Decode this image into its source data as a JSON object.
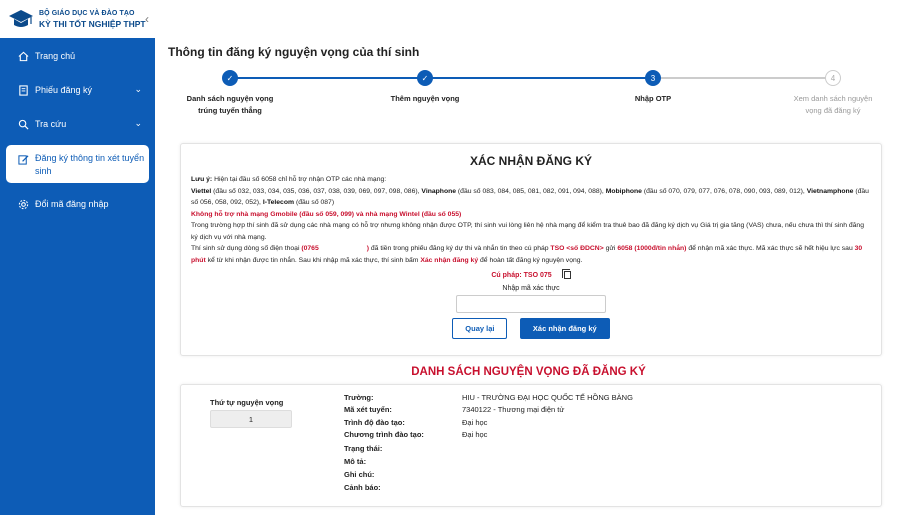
{
  "brand": {
    "line1": "BỘ GIÁO DỤC VÀ ĐÀO TẠO",
    "line2": "KỲ THI TỐT NGHIỆP THPT"
  },
  "sidebar": {
    "items": [
      {
        "label": "Trang chủ",
        "icon": "home-icon"
      },
      {
        "label": "Phiếu đăng ký",
        "icon": "document-icon"
      },
      {
        "label": "Tra cứu",
        "icon": "search-icon"
      },
      {
        "label": "Đăng ký thông tin xét tuyển sinh",
        "icon": "edit-icon"
      },
      {
        "label": "Đổi mã đăng nhập",
        "icon": "gear-icon"
      }
    ]
  },
  "page": {
    "title": "Thông tin đăng ký nguyện vọng của thí sinh"
  },
  "stepper": {
    "steps": [
      {
        "label": "Danh sách nguyện vọng trúng tuyển thẳng",
        "number": "",
        "state": "done"
      },
      {
        "label": "Thêm nguyện vọng",
        "number": "",
        "state": "done"
      },
      {
        "label": "Nhập OTP",
        "number": "3",
        "state": "active"
      },
      {
        "label": "Xem danh sách nguyện vọng đã đăng ký",
        "number": "4",
        "state": "todo"
      }
    ]
  },
  "otp": {
    "title": "XÁC NHẬN ĐĂNG KÝ",
    "note_label": "Lưu ý:",
    "note_text": "Hiện tại đầu số 6058 chỉ hỗ trợ nhận OTP các nhà mạng:",
    "viettel_name": "Viettel",
    "viettel_prefixes": "(đầu số 032, 033, 034, 035, 036, 037, 038, 039, 069, 097, 098, 086),",
    "vinaphone_name": "Vinaphone",
    "vinaphone_prefixes": "(đầu số 083, 084, 085, 081, 082, 091, 094, 088),",
    "mobiphone_name": "Mobiphone",
    "mobiphone_prefixes": "(đầu số 070, 079, 077, 076, 078, 090, 093, 089, 012),",
    "vietnamphone_name": "Vietnamphone",
    "vietnamphone_prefixes": "(đầu số 056, 058, 092, 052),",
    "itelecom_name": "I-Telecom",
    "itelecom_prefixes": "(đầu số 087)",
    "unsupported": "Không hỗ trợ nhà mạng Gmobile (đầu số 059, 099) và nhà mạng Wintel (đầu số 055)",
    "vas_note": "Trong trường hợp thí sinh đã sử dụng các nhà mạng có hỗ trợ nhưng không nhận được OTP, thí sinh vui lòng liên hệ nhà mạng để kiểm tra thuê bao đã đăng ký dịch vụ Giá trị gia tăng (VAS) chưa, nếu chưa thì thí sinh đăng ký dịch vụ với nhà mạng.",
    "phone_intro": "Thí sinh sử dụng dòng số điện thoại",
    "phone_value": "(0765",
    "phone_close": ")",
    "phone_mid": "đã tiền trong phiếu đăng ký dự thi và nhắn tin theo cú pháp",
    "sms_syntax": "TSO <số ĐDCN>",
    "send_to": "gửi",
    "shortcode": "6058 (1000đ/tin nhắn)",
    "after_send": "để nhận mã xác thực. Mã xác thực sẽ hết hiệu lực sau",
    "expiry": "30 phút",
    "after_expiry": "kể từ khi nhận được tin nhắn. Sau khi nhập mã xác thực, thí sinh bấm",
    "confirm_word": "Xác nhận đăng ký",
    "final_text": "để hoàn tất đăng ký nguyện vọng.",
    "syntax_label": "Cú pháp:",
    "syntax_value": "TSO 075",
    "input_label": "Nhập mã xác thực",
    "input_value": "",
    "back_label": "Quay lại",
    "confirm_label": "Xác nhận đăng ký"
  },
  "list": {
    "title": "DANH SÁCH NGUYỆN VỌNG ĐÃ ĐĂNG KÝ",
    "order_label": "Thứ tự nguyện vọng",
    "order_value": "1",
    "fields": [
      {
        "label": "Trường:",
        "value": "HIU - TRƯỜNG ĐẠI HỌC QUỐC TẾ HỒNG BÀNG"
      },
      {
        "label": "Mã xét tuyển:",
        "value": "7340122 - Thương mại điện tử"
      },
      {
        "label": "Trình độ đào tạo:",
        "value": "Đại học"
      },
      {
        "label": "Chương trình đào tạo:",
        "value": "Đại học"
      },
      {
        "label": "Trạng thái:",
        "value": ""
      },
      {
        "label": "Mô tả:",
        "value": ""
      },
      {
        "label": "Ghi chú:",
        "value": ""
      },
      {
        "label": "Cảnh báo:",
        "value": ""
      }
    ]
  }
}
